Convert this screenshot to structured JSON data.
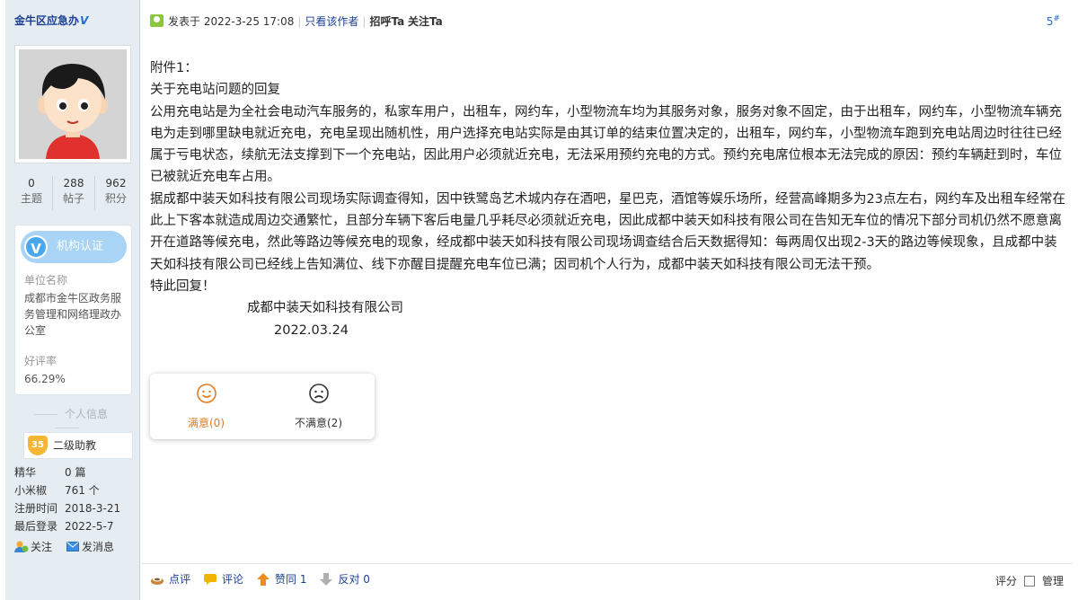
{
  "user": {
    "name": "金牛区应急办",
    "verified_mark": "V",
    "stats": [
      {
        "value": "0",
        "label": "主题"
      },
      {
        "value": "288",
        "label": "帖子"
      },
      {
        "value": "962",
        "label": "积分"
      }
    ],
    "cert": {
      "badge": "V",
      "label": "机构认证",
      "unit_label": "单位名称",
      "unit_value": "成都市金牛区政务服务管理和网络理政办公室",
      "rate_label": "好评率",
      "rate_value": "66.29%"
    },
    "section_title": "个人信息",
    "level": {
      "badge": "35",
      "label": "二级助教"
    },
    "info": [
      {
        "key": "精华",
        "value": "0 篇"
      },
      {
        "key": "小米椒",
        "value": "761 个"
      },
      {
        "key": "注册时间",
        "value": "2018-3-21"
      },
      {
        "key": "最后登录",
        "value": "2022-5-7"
      }
    ],
    "actions": {
      "follow": "关注",
      "message": "发消息"
    }
  },
  "post": {
    "posted_prefix": "发表于",
    "posted_time": "2022-3-25 17:08",
    "author_only": "只看该作者",
    "greet": "招呼Ta",
    "follow": "关注Ta",
    "floor": "5",
    "floor_mark": "#",
    "paragraphs": [
      "附件1：",
      "关于充电站问题的回复",
      "公用充电站是为全社会电动汽车服务的，私家车用户，出租车，网约车，小型物流车均为其服务对象，服务对象不固定，由于出租车，网约车，小型物流车辆充电为走到哪里缺电就近充电，充电呈现出随机性，用户选择充电站实际是由其订单的结束位置决定的，出租车，网约车，小型物流车跑到充电站周边时往往已经属于亏电状态，续航无法支撑到下一个充电站，因此用户必须就近充电，无法采用预约充电的方式。预约充电席位根本无法完成的原因：预约车辆赶到时，车位已被就近充电车占用。",
      "据成都中装天如科技有限公司现场实际调查得知，因中铁鹭岛艺术城内存在酒吧，星巴克，酒馆等娱乐场所，经营高峰期多为23点左右，网约车及出租车经常在此上下客本就造成周边交通繁忙，且部分车辆下客后电量几乎耗尽必须就近充电，因此成都中装天如科技有限公司在告知无车位的情况下部分司机仍然不愿意离开在道路等候充电，然此等路边等候充电的现象，经成都中装天如科技有限公司现场调查结合后天数据得知：每两周仅出现2-3天的路边等候现象，且成都中装天如科技有限公司已经线上告知满位、线下亦醒目提醒充电车位已满；因司机个人行为，成都中装天如科技有限公司无法干预。",
      "特此回复！"
    ],
    "signature_company": "成都中装天如科技有限公司",
    "signature_date": "2022.03.24",
    "rating": {
      "good": "满意(0)",
      "bad": "不满意(2)"
    },
    "bottom": {
      "comment_rate": "点评",
      "comment": "评论",
      "agree": "赞同 1",
      "oppose": "反对 0",
      "score": "评分",
      "manage": "管理"
    }
  },
  "colors": {
    "sidebar_bg": "#e5edf2",
    "link_blue": "#1c3f95",
    "cert_pill": "#a9d4f5",
    "good_orange": "#e07b20"
  }
}
